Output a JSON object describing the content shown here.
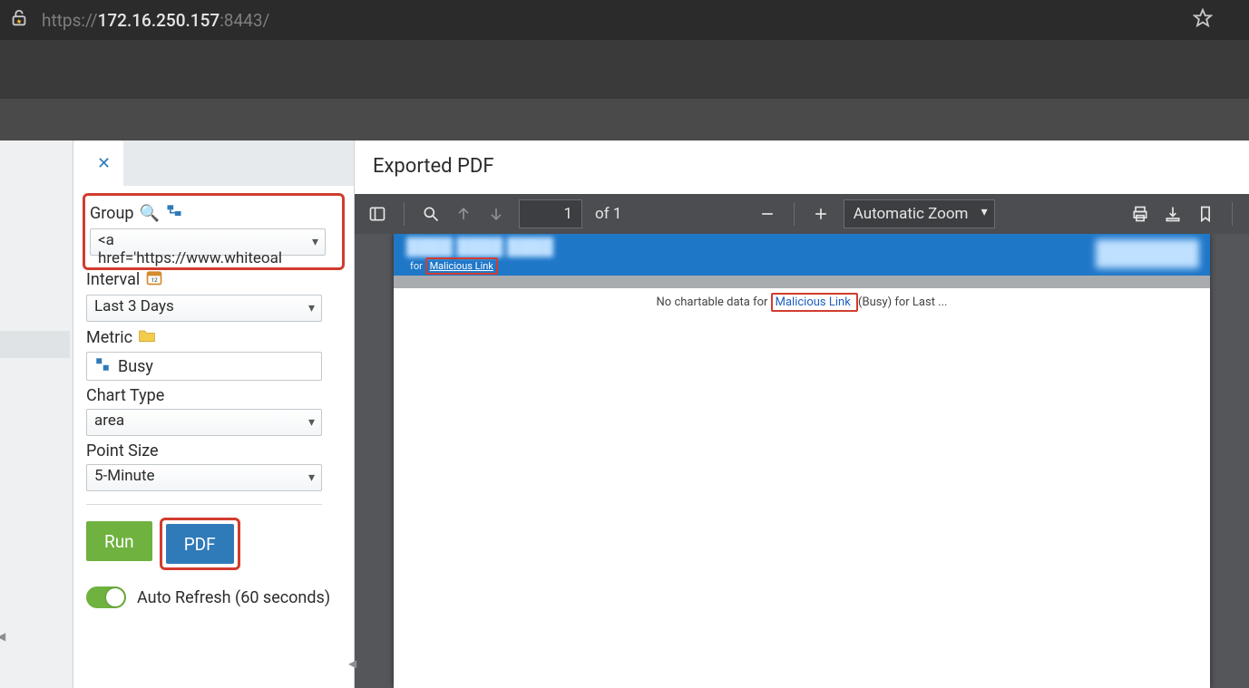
{
  "browser": {
    "url_prefix": "https://",
    "url_host": "172.16.250.157",
    "url_port": ":8443/",
    "url_rest": "                         "
  },
  "header": {
    "text1": "                    ",
    "text2": "                "
  },
  "tab": {
    "label": "                          "
  },
  "panel": {
    "group_label": "Group",
    "group_value": "<a href='https://www.whiteoal",
    "interval_label": "Interval",
    "interval_value": "Last 3 Days",
    "metric_label": "Metric",
    "metric_value": "Busy",
    "chart_type_label": "Chart Type",
    "chart_type_value": "area",
    "point_size_label": "Point Size",
    "point_size_value": "5-Minute",
    "run_label": "Run",
    "pdf_label": "PDF",
    "auto_refresh_label": "Auto Refresh (60 seconds)"
  },
  "content": {
    "title": "Exported PDF"
  },
  "pdf": {
    "page_current": "1",
    "page_of": "of 1",
    "zoom_value": "Automatic Zoom",
    "banner_for": "for",
    "banner_link": "Malicious Link",
    "msg_pre": "No chartable data for ",
    "msg_link": "Malicious Link",
    "msg_post": " (Busy) for Last ..."
  }
}
